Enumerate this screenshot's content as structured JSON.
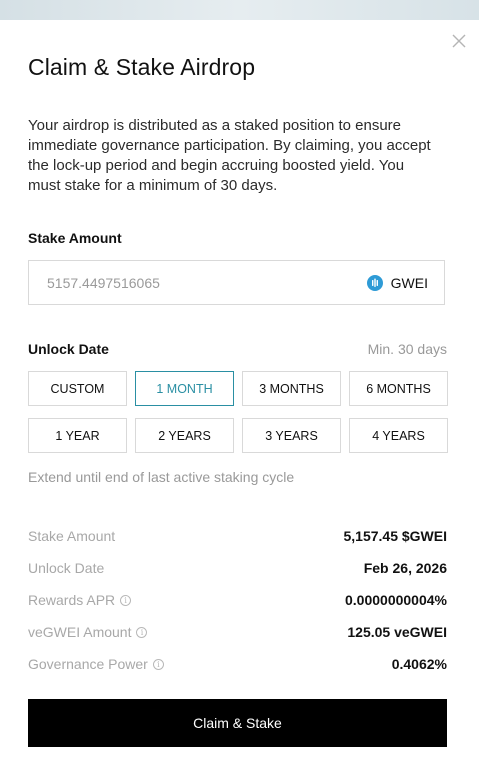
{
  "modal": {
    "title": "Claim & Stake Airdrop",
    "description": "Your airdrop is distributed as a staked position to ensure immediate governance participation. By claiming, you accept the lock-up period and begin accruing boosted yield. You must stake for a minimum of 30 days."
  },
  "stake": {
    "label": "Stake Amount",
    "placeholder": "5157.4497516065",
    "token_label": "GWEI",
    "token_icon": "gwei-token-icon"
  },
  "unlock": {
    "label": "Unlock Date",
    "min_note": "Min. 30 days",
    "options": [
      "CUSTOM",
      "1 MONTH",
      "3 MONTHS",
      "6 MONTHS",
      "1 YEAR",
      "2 YEARS",
      "3 YEARS",
      "4 YEARS"
    ],
    "selected": "1 MONTH",
    "extend_text": "Extend until end of last active staking cycle"
  },
  "summary": {
    "stake_amount": {
      "label": "Stake Amount",
      "value": "5,157.45 $GWEI"
    },
    "unlock_date": {
      "label": "Unlock Date",
      "value": "Feb 26, 2026"
    },
    "rewards_apr": {
      "label": "Rewards APR",
      "value": "0.0000000004%"
    },
    "vegwei_amount": {
      "label": "veGWEI Amount",
      "value": "125.05 veGWEI"
    },
    "governance_power": {
      "label": "Governance Power",
      "value": "0.4062%"
    }
  },
  "cta": {
    "label": "Claim & Stake"
  },
  "colors": {
    "accent": "#2a8fa3",
    "token": "#2e9bd6",
    "button": "#000000"
  }
}
